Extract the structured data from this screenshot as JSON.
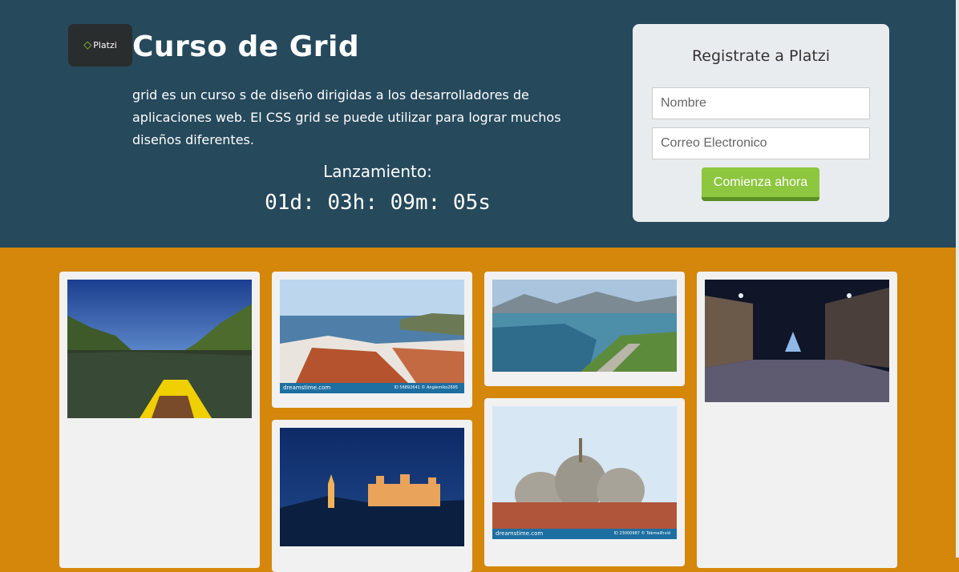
{
  "header": {
    "logo_text": "Platzi",
    "title": "Curso de Grid",
    "description": "grid es un curso s de diseño dirigidas a los desarrolladores de aplicaciones web. El CSS grid se puede utilizar para lograr muchos diseños diferentes.",
    "launch_label": "Lanzamiento:",
    "countdown": "01d: 03h: 09m: 05s"
  },
  "register": {
    "title": "Registrate a Platzi",
    "name_placeholder": "Nombre",
    "email_placeholder": "Correo Electronico",
    "submit_label": "Comienza ahora"
  },
  "gallery": {
    "watermark": "dreamstime.com",
    "photo_ids": [
      "ID 56892641 © Angiemiko2695",
      "ID 23000987 © Tebmeilhvid"
    ]
  },
  "colors": {
    "header_bg": "#26495c",
    "page_bg": "#d4870a",
    "button": "#8dc63f"
  }
}
